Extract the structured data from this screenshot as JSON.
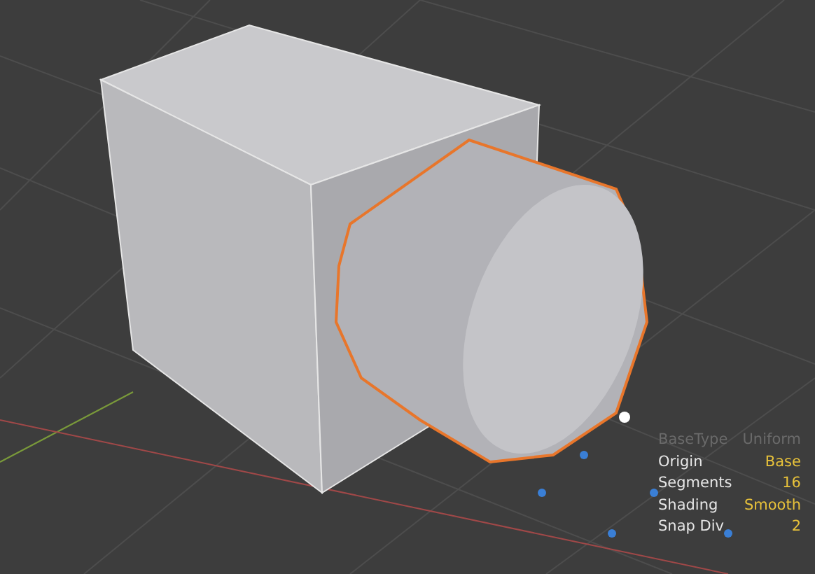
{
  "viewport": {
    "properties": [
      {
        "label": "BaseType",
        "value": "Uniform",
        "disabled": true
      },
      {
        "label": "Origin",
        "value": "Base",
        "disabled": false
      },
      {
        "label": "Segments",
        "value": "16",
        "disabled": false
      },
      {
        "label": "Shading",
        "value": "Smooth",
        "disabled": false
      },
      {
        "label": "Snap Div",
        "value": "2",
        "disabled": false
      }
    ]
  }
}
